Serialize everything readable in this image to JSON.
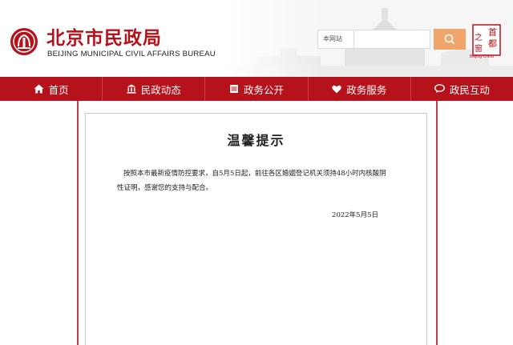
{
  "header": {
    "logo_cn": "北京市民政局",
    "logo_en": "BEIJING MUNICIPAL CIVIL AFFAIRS BUREAU",
    "search_scope": "本网站",
    "search_placeholder": "",
    "capital_badge_chars": [
      "首",
      "都",
      "之",
      "窗"
    ],
    "capital_badge_caption": "Beijing·China"
  },
  "nav": {
    "items": [
      {
        "label": "首页",
        "icon": "home-icon"
      },
      {
        "label": "民政动态",
        "icon": "building-icon"
      },
      {
        "label": "政务公开",
        "icon": "document-icon"
      },
      {
        "label": "政务服务",
        "icon": "heart-icon"
      },
      {
        "label": "政民互动",
        "icon": "chat-icon"
      }
    ]
  },
  "notice": {
    "title": "温馨提示",
    "body": "按照本市最新疫情防控要求，自5月5日起，前往各区婚姻登记机关须持48小时内核酸阴性证明，感谢您的支持与配合。",
    "date": "2022年5月5日"
  },
  "colors": {
    "brand_red": "#b5121b",
    "search_button": "#f0a56a"
  }
}
